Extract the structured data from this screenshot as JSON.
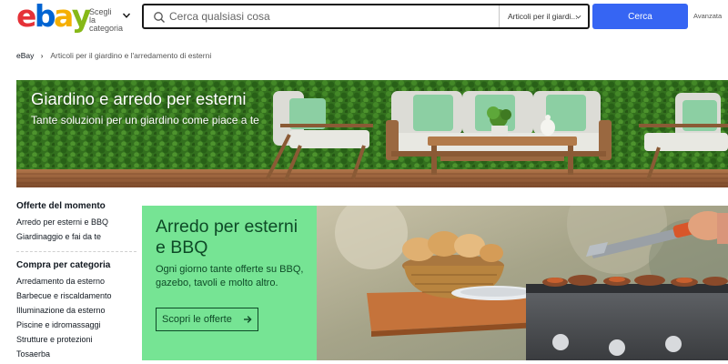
{
  "header": {
    "logo_letters": [
      {
        "char": "e",
        "color": "#e53238"
      },
      {
        "char": "b",
        "color": "#0064d2"
      },
      {
        "char": "a",
        "color": "#f5af02"
      },
      {
        "char": "y",
        "color": "#86b817"
      }
    ],
    "shop_by_category": "Scegli la categoria",
    "search": {
      "placeholder": "Cerca qualsiasi cosa",
      "value": "",
      "category_selected": "Articoli per il giardi..."
    },
    "search_button": "Cerca",
    "advanced_link": "Avanzata"
  },
  "breadcrumb": {
    "home": "eBay",
    "current": "Articoli per il giardino e l'arredamento di esterni"
  },
  "hero": {
    "title": "Giardino e arredo per esterni",
    "subtitle": "Tante soluzioni per un giardino come piace a te"
  },
  "sidebar": {
    "deals_heading": "Offerte del momento",
    "deals": [
      {
        "label": "Arredo per esterni e BBQ"
      },
      {
        "label": "Giardinaggio e fai da te"
      }
    ],
    "category_heading": "Compra per categoria",
    "categories": [
      {
        "label": "Arredamento da esterno"
      },
      {
        "label": "Barbecue e riscaldamento"
      },
      {
        "label": "Illuminazione da esterno"
      },
      {
        "label": "Piscine e idromassaggi"
      },
      {
        "label": "Strutture e protezioni"
      },
      {
        "label": "Tosaerba"
      }
    ]
  },
  "promo": {
    "title": "Arredo per esterni e BBQ",
    "description": "Ogni giorno tante offerte su BBQ, gazebo, tavoli e molto altro.",
    "button": "Scopri le offerte",
    "background_color": "#76e494",
    "text_color": "#0e4a27"
  },
  "colors": {
    "accent": "#3665f3",
    "text": "#111820"
  },
  "icons": {
    "search": "search-icon",
    "chevron": "chevron-down-icon",
    "breadcrumb_separator": "chevron-right-icon",
    "arrow": "arrow-right-icon"
  }
}
